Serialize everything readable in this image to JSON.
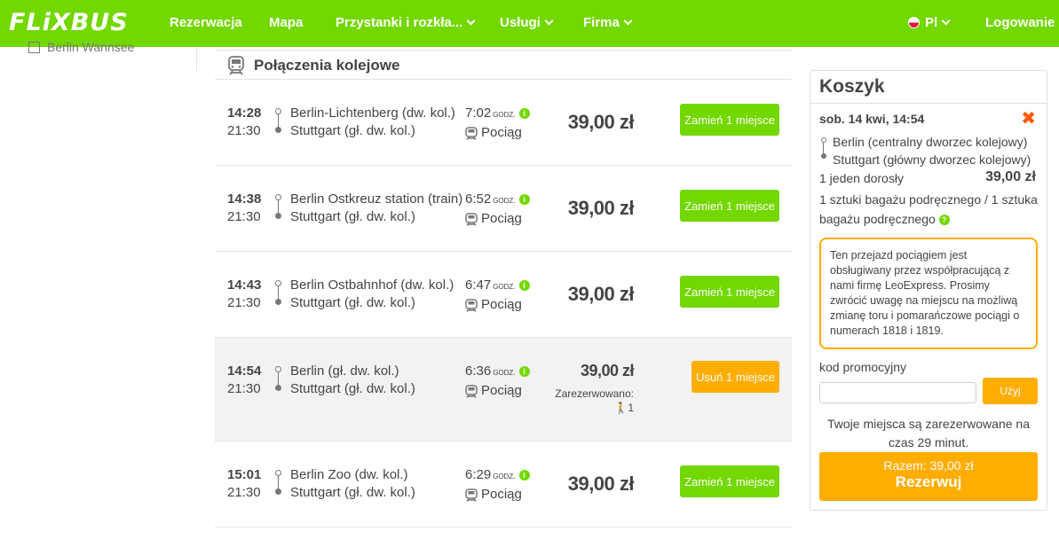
{
  "brand": {
    "logo": "FLiXBUS",
    "primary_color": "#73d700",
    "accent_color": "#ffad00"
  },
  "nav": {
    "items": [
      {
        "label": "Rezerwacja",
        "has_dropdown": false
      },
      {
        "label": "Mapa",
        "has_dropdown": false
      },
      {
        "label": "Przystanki i rozkła...",
        "has_dropdown": true
      },
      {
        "label": "Usługi",
        "has_dropdown": true
      },
      {
        "label": "Firma",
        "has_dropdown": true
      }
    ],
    "language": "Pl",
    "login": "Logowanie"
  },
  "sidebar": {
    "item": "Berlin Wannsee"
  },
  "section": {
    "title": "Połączenia kolejowe"
  },
  "connections": [
    {
      "dep": "14:28",
      "arr": "21:30",
      "from": "Berlin-Lichtenberg (dw. kol.)",
      "to": "Stuttgart (gł. dw. kol.)",
      "duration": "7:02",
      "duration_unit": "GODZ.",
      "mode": "Pociąg",
      "price": "39,00 zł",
      "action": "Zamień 1 miejsce",
      "selected": false
    },
    {
      "dep": "14:38",
      "arr": "21:30",
      "from": "Berlin Ostkreuz station (train)",
      "to": "Stuttgart (gł. dw. kol.)",
      "duration": "6:52",
      "duration_unit": "GODZ.",
      "mode": "Pociąg",
      "price": "39,00 zł",
      "action": "Zamień 1 miejsce",
      "selected": false
    },
    {
      "dep": "14:43",
      "arr": "21:30",
      "from": "Berlin Ostbahnhof (dw. kol.)",
      "to": "Stuttgart (gł. dw. kol.)",
      "duration": "6:47",
      "duration_unit": "GODZ.",
      "mode": "Pociąg",
      "price": "39,00 zł",
      "action": "Zamień 1 miejsce",
      "selected": false
    },
    {
      "dep": "14:54",
      "arr": "21:30",
      "from": "Berlin (gł. dw. kol.)",
      "to": "Stuttgart (gł. dw. kol.)",
      "duration": "6:36",
      "duration_unit": "GODZ.",
      "mode": "Pociąg",
      "price": "39,00 zł",
      "action": "Usuń 1 miejsce",
      "selected": true,
      "reserved_label": "Zarezerwowano:",
      "reserved_count": "1"
    },
    {
      "dep": "15:01",
      "arr": "21:30",
      "from": "Berlin Zoo (dw. kol.)",
      "to": "Stuttgart (gł. dw. kol.)",
      "duration": "6:29",
      "duration_unit": "GODZ.",
      "mode": "Pociąg",
      "price": "39,00 zł",
      "action": "Zamień 1 miejsce",
      "selected": false
    }
  ],
  "cart": {
    "title": "Koszyk",
    "date": "sob. 14 kwi, 14:54",
    "from": "Berlin (centralny dworzec kolejowy)",
    "to": "Stuttgart (główny dworzec kolejowy)",
    "passengers": "1 jeden dorosły",
    "price": "39,00 zł",
    "baggage": "1 sztuki bagażu podręcznego / 1 sztuka bagażu podręcznego",
    "notice": "Ten przejazd pociągiem jest obsługiwany przez współpracującą z nami firmę LeoExpress. Prosimy zwrócić uwagę na miejscu na możliwą zmianę toru i pomarańczowe pociągi o numerach 1818 i 1819.",
    "promo_label": "kod promocyjny",
    "promo_value": "",
    "promo_button": "Użyj",
    "timer_text": "Twoje miejsca są zarezerwowane na czas 29 minut.",
    "total": "Razem: 39,00 zł",
    "book_button": "Rezerwuj"
  }
}
